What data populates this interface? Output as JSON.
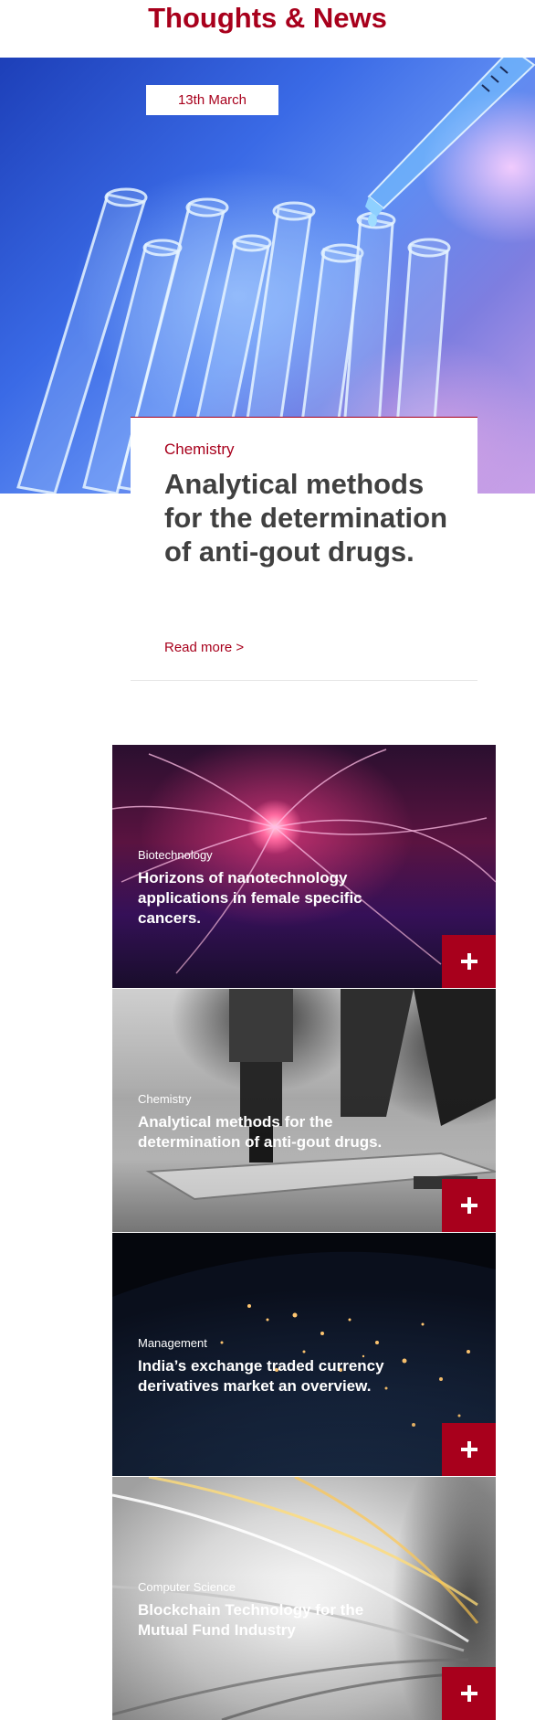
{
  "page": {
    "title": "Thoughts & News"
  },
  "featured": {
    "date": "13th March",
    "category": "Chemistry",
    "title": "Analytical methods for the determination of anti-gout drugs.",
    "read_more": "Read more >"
  },
  "cards": [
    {
      "category": "Biotechnology",
      "title": "Horizons of nanotechnology applications in female specific cancers.",
      "button_icon": "plus-icon"
    },
    {
      "category": "Chemistry",
      "title": "Analytical methods for the determination of anti-gout drugs.",
      "button_icon": "plus-icon"
    },
    {
      "category": "Management",
      "title": "India’s exchange traded currency derivatives market an overview.",
      "button_icon": "plus-icon"
    },
    {
      "category": "Computer Science",
      "title": "Blockchain Technology for the Mutual Fund Industry",
      "button_icon": "plus-icon"
    }
  ],
  "colors": {
    "accent": "#a8001c",
    "heading_text": "#404040",
    "background": "#ffffff"
  }
}
